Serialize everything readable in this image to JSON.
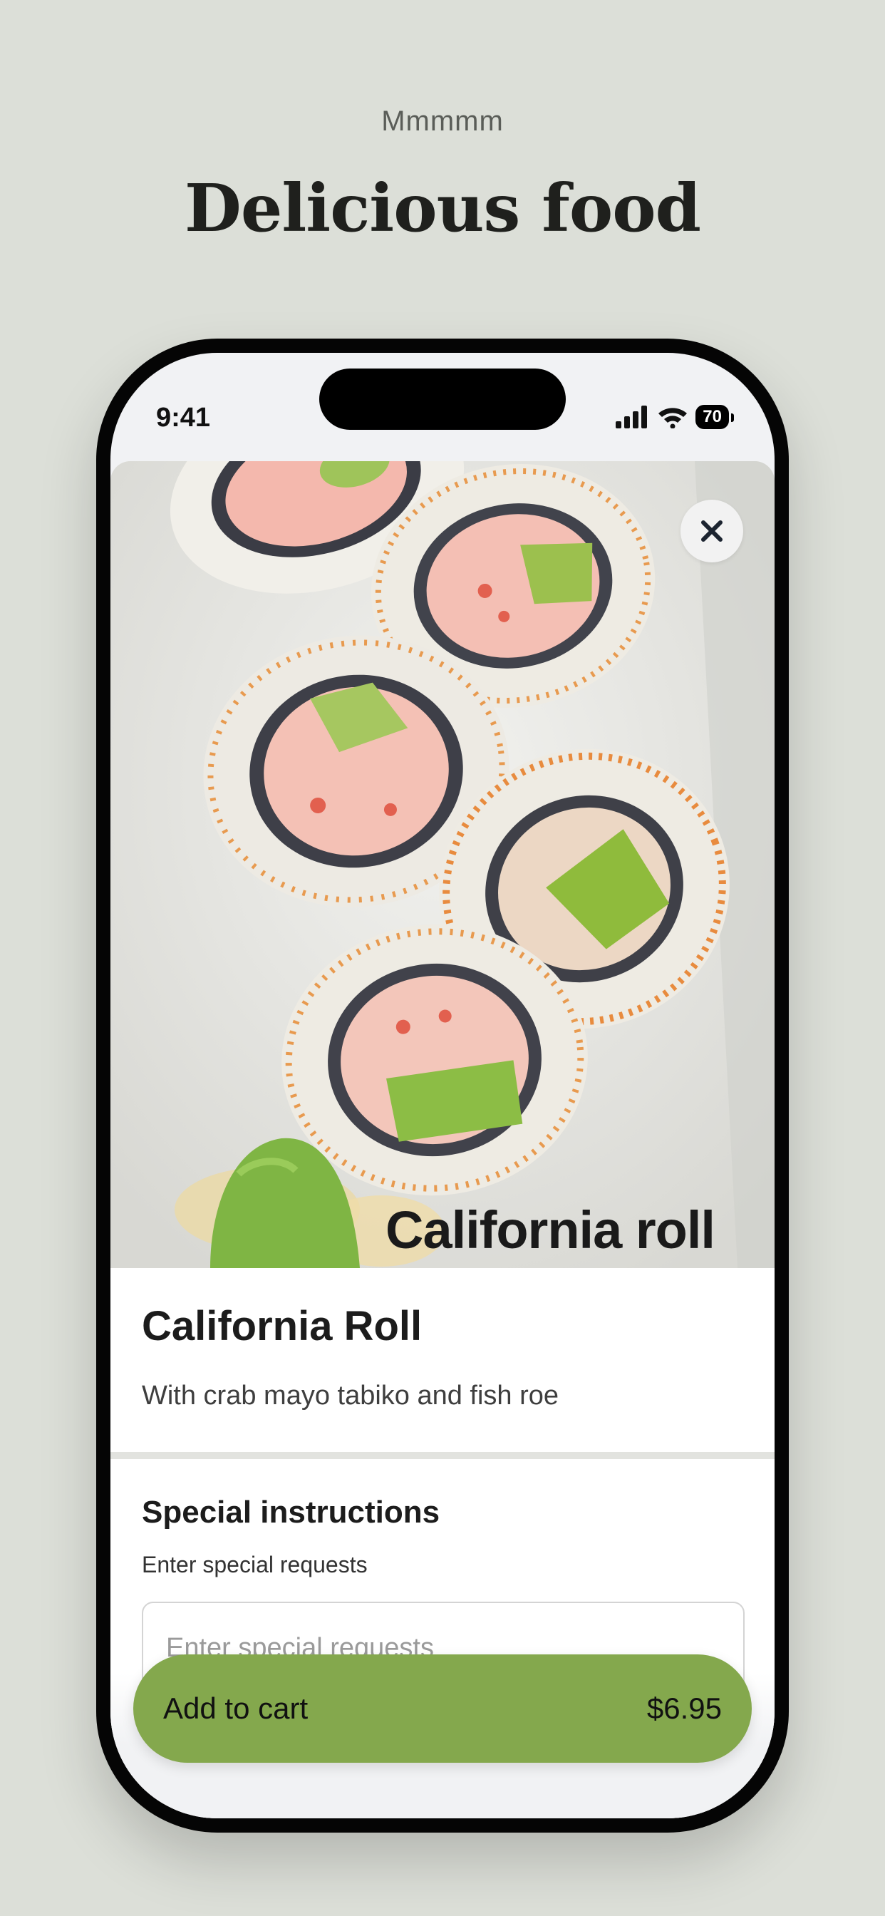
{
  "promo": {
    "eyebrow": "Mmmmm",
    "headline": "Delicious food"
  },
  "status_bar": {
    "time": "9:41",
    "battery": "70",
    "icons": [
      "signal-icon",
      "wifi-icon",
      "battery-icon"
    ]
  },
  "item": {
    "image_caption": "California roll",
    "name": "California Roll",
    "description": "With crab mayo tabiko and fish roe"
  },
  "special_instructions": {
    "title": "Special instructions",
    "label": "Enter special requests",
    "placeholder": "Enter special requests"
  },
  "cart": {
    "label": "Add to cart",
    "price": "$6.95"
  },
  "colors": {
    "background": "#dcdfd8",
    "accent": "#84a84d"
  }
}
